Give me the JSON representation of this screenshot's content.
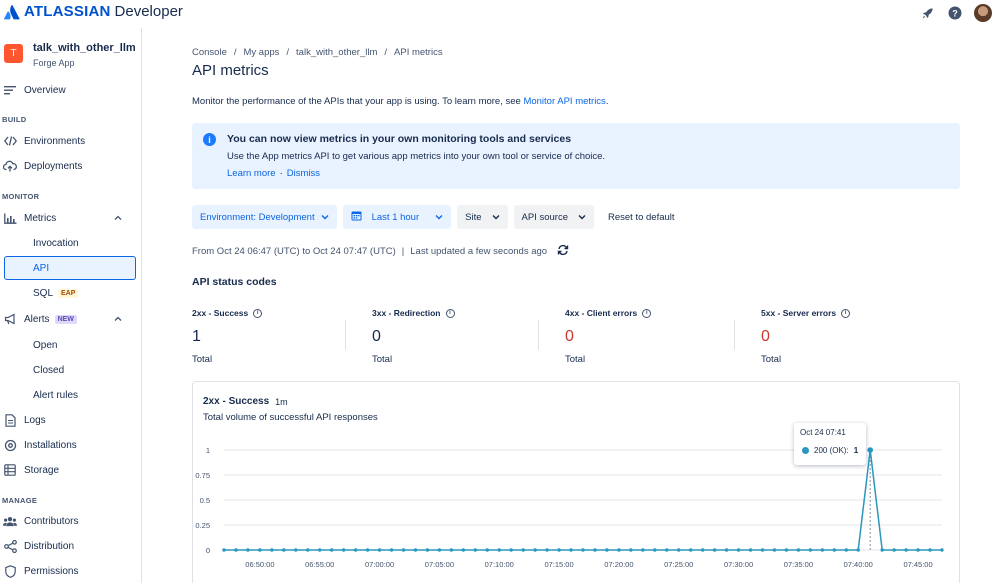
{
  "header": {
    "brand": "ATLASSIAN",
    "product": "Developer",
    "icons": [
      "rocket-icon",
      "help-icon",
      "avatar"
    ]
  },
  "sidebar": {
    "app_initial": "T",
    "app_name": "talk_with_other_llm",
    "app_type": "Forge App",
    "overview": "Overview",
    "build_label": "BUILD",
    "environments": "Environments",
    "deployments": "Deployments",
    "monitor_label": "MONITOR",
    "metrics": "Metrics",
    "invocation": "Invocation",
    "api": "API",
    "sql": "SQL",
    "sql_badge": "EAP",
    "alerts": "Alerts",
    "alerts_badge": "NEW",
    "open": "Open",
    "closed": "Closed",
    "alert_rules": "Alert rules",
    "logs": "Logs",
    "installations": "Installations",
    "storage": "Storage",
    "manage_label": "MANAGE",
    "contributors": "Contributors",
    "distribution": "Distribution",
    "permissions": "Permissions"
  },
  "breadcrumb": [
    "Console",
    "My apps",
    "talk_with_other_llm",
    "API metrics"
  ],
  "page_title": "API metrics",
  "intro": {
    "text": "Monitor the performance of the APIs that your app is using. To learn more, see ",
    "link": "Monitor API metrics",
    "end": "."
  },
  "banner": {
    "title": "You can now view metrics in your own monitoring tools and services",
    "text": "Use the App metrics API to get various app metrics into your own tool or service of choice.",
    "learn_more": "Learn more",
    "separator": "·",
    "dismiss": "Dismiss"
  },
  "filters": {
    "environment": "Environment: Development",
    "time": "Last 1 hour",
    "site": "Site",
    "api_source": "API source",
    "reset": "Reset to default"
  },
  "range": {
    "text": "From Oct 24 06:47 (UTC) to Oct 24 07:47 (UTC)",
    "sep": "|",
    "updated": "Last updated a few seconds ago"
  },
  "status_section": "API status codes",
  "stats": [
    {
      "label": "2xx - Success",
      "value": "1",
      "total": "Total"
    },
    {
      "label": "3xx - Redirection",
      "value": "0",
      "total": "Total"
    },
    {
      "label": "4xx - Client errors",
      "value": "0",
      "total": "Total"
    },
    {
      "label": "5xx - Server errors",
      "value": "0",
      "total": "Total"
    }
  ],
  "chart_card": {
    "title": "2xx - Success",
    "granularity": "1m",
    "subtitle": "Total volume of successful API responses"
  },
  "tooltip": {
    "time": "Oct 24 07:41",
    "series": "200 (OK):",
    "value": "1"
  },
  "colors": {
    "series": "#2898bd",
    "accent": "#0c66e4",
    "error": "#c9372c"
  },
  "chart_data": {
    "type": "line",
    "title": "2xx - Success",
    "xlabel": "",
    "ylabel": "",
    "ylim": [
      0,
      1
    ],
    "yticks": [
      "0",
      "0.25",
      "0.5",
      "0.75",
      "1"
    ],
    "xticks": [
      "06:50:00",
      "06:55:00",
      "07:00:00",
      "07:05:00",
      "07:10:00",
      "07:15:00",
      "07:20:00",
      "07:25:00",
      "07:30:00",
      "07:35:00",
      "07:40:00",
      "07:45:00"
    ],
    "x_start": "06:47",
    "x_step_minutes": 1,
    "series": [
      {
        "name": "200 (OK)",
        "values": [
          0,
          0,
          0,
          0,
          0,
          0,
          0,
          0,
          0,
          0,
          0,
          0,
          0,
          0,
          0,
          0,
          0,
          0,
          0,
          0,
          0,
          0,
          0,
          0,
          0,
          0,
          0,
          0,
          0,
          0,
          0,
          0,
          0,
          0,
          0,
          0,
          0,
          0,
          0,
          0,
          0,
          0,
          0,
          0,
          0,
          0,
          0,
          0,
          0,
          0,
          0,
          0,
          0,
          0,
          1,
          0,
          0,
          0,
          0,
          0,
          0
        ]
      }
    ],
    "grid": true
  }
}
